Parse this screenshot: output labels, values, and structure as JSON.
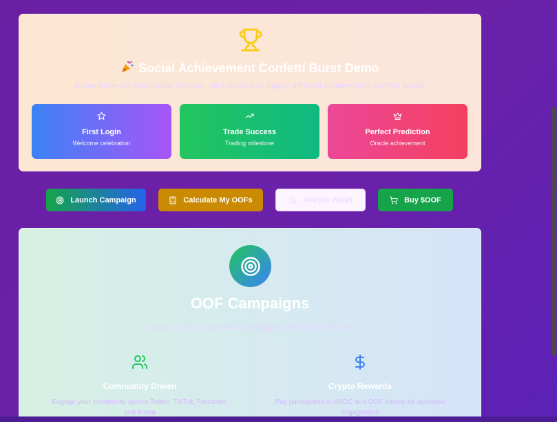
{
  "confetti": {
    "title": "Social Achievement Confetti Burst Demo",
    "subtitle": "Experience our celebration system - click buttons to trigger different achievement confetti bursts",
    "cards": [
      {
        "title": "First Login",
        "subtitle": "Welcome celebration",
        "icon": "star-icon"
      },
      {
        "title": "Trade Success",
        "subtitle": "Trading milestone",
        "icon": "trending-up-icon"
      },
      {
        "title": "Perfect Prediction",
        "subtitle": "Oracle achievement",
        "icon": "crown-icon"
      }
    ]
  },
  "actions": {
    "launch": "Launch Campaign",
    "calculate": "Calculate My OOFs",
    "analyze": "Analyze Wallet",
    "buy": "Buy $OOF"
  },
  "campaigns": {
    "title": "OOF Campaigns",
    "subtitle": "Launch viral social media campaigns with crypto rewards",
    "features": [
      {
        "title": "Community Driven",
        "description": "Engage your community across Twitter, TikTok, Farcaster, and Arena",
        "icon": "users-icon"
      },
      {
        "title": "Crypto Rewards",
        "description": "Pay participants in USDC and OOF tokens for authentic engagement",
        "icon": "dollar-icon"
      }
    ]
  },
  "colors": {
    "background": "#6b21a8",
    "trophy": "#facc15",
    "launch_gradient": [
      "#16a34a",
      "#2563eb"
    ],
    "calculate": "#ca8a04",
    "buy": "#16a34a",
    "community_icon": "#22c55e",
    "rewards_icon": "#3b82f6"
  }
}
